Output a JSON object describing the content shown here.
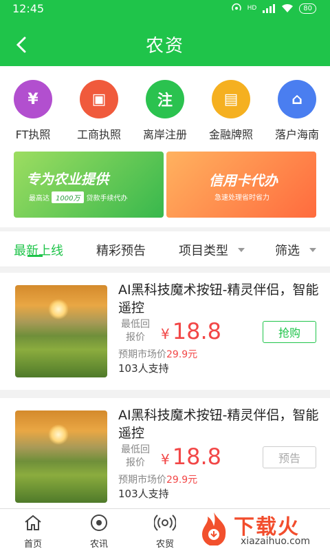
{
  "status": {
    "time": "12:45",
    "battery": "80",
    "network": "HD"
  },
  "header": {
    "title": "农资"
  },
  "quick_items": [
    {
      "label": "FT执照",
      "icon": "atm-icon",
      "color": "#b24fcf",
      "glyph": "¥"
    },
    {
      "label": "工商执照",
      "icon": "id-card-icon",
      "color": "#f05a3c",
      "glyph": "▣"
    },
    {
      "label": "离岸注册",
      "icon": "register-icon",
      "color": "#2bc24f",
      "glyph": "注"
    },
    {
      "label": "金融牌照",
      "icon": "wallet-icon",
      "color": "#f5b020",
      "glyph": "▤"
    },
    {
      "label": "落户海南",
      "icon": "home-icon",
      "color": "#4a7ef0",
      "glyph": "⌂"
    }
  ],
  "banners": {
    "left": {
      "title": "专为农业提供",
      "prefix": "最高达",
      "amount": "1000万",
      "suffix": "贷款手续代办"
    },
    "right": {
      "title": "信用卡代办",
      "subtitle": "急速处理省时省力"
    }
  },
  "tabs": [
    {
      "label": "最新上线",
      "active": true
    },
    {
      "label": "精彩预告",
      "active": false
    },
    {
      "label": "项目类型",
      "active": false,
      "dropdown": true
    },
    {
      "label": "筛选",
      "active": false,
      "dropdown": true
    }
  ],
  "products": [
    {
      "title": "AI黑科技魔术按钮-精灵伴侣，智能遥控",
      "low_label": "最低回报价",
      "currency": "¥",
      "price": "18.8",
      "market_label": "预期市场价",
      "market_price": "29.9元",
      "support": "103人支持",
      "action": "抢购",
      "action_style": "buy"
    },
    {
      "title": "AI黑科技魔术按钮-精灵伴侣，智能遥控",
      "low_label": "最低回报价",
      "currency": "¥",
      "price": "18.8",
      "market_label": "预期市场价",
      "market_price": "29.9元",
      "support": "103人支持",
      "action": "预告",
      "action_style": "preview"
    }
  ],
  "bottom_nav": [
    {
      "label": "首页",
      "icon": "home-icon"
    },
    {
      "label": "农讯",
      "icon": "news-icon"
    },
    {
      "label": "农贸",
      "icon": "broadcast-icon"
    }
  ],
  "watermark": {
    "title": "下载火",
    "url": "xiazaihuo.com"
  },
  "colors": {
    "primary": "#1fc44a",
    "price": "#f24747"
  }
}
